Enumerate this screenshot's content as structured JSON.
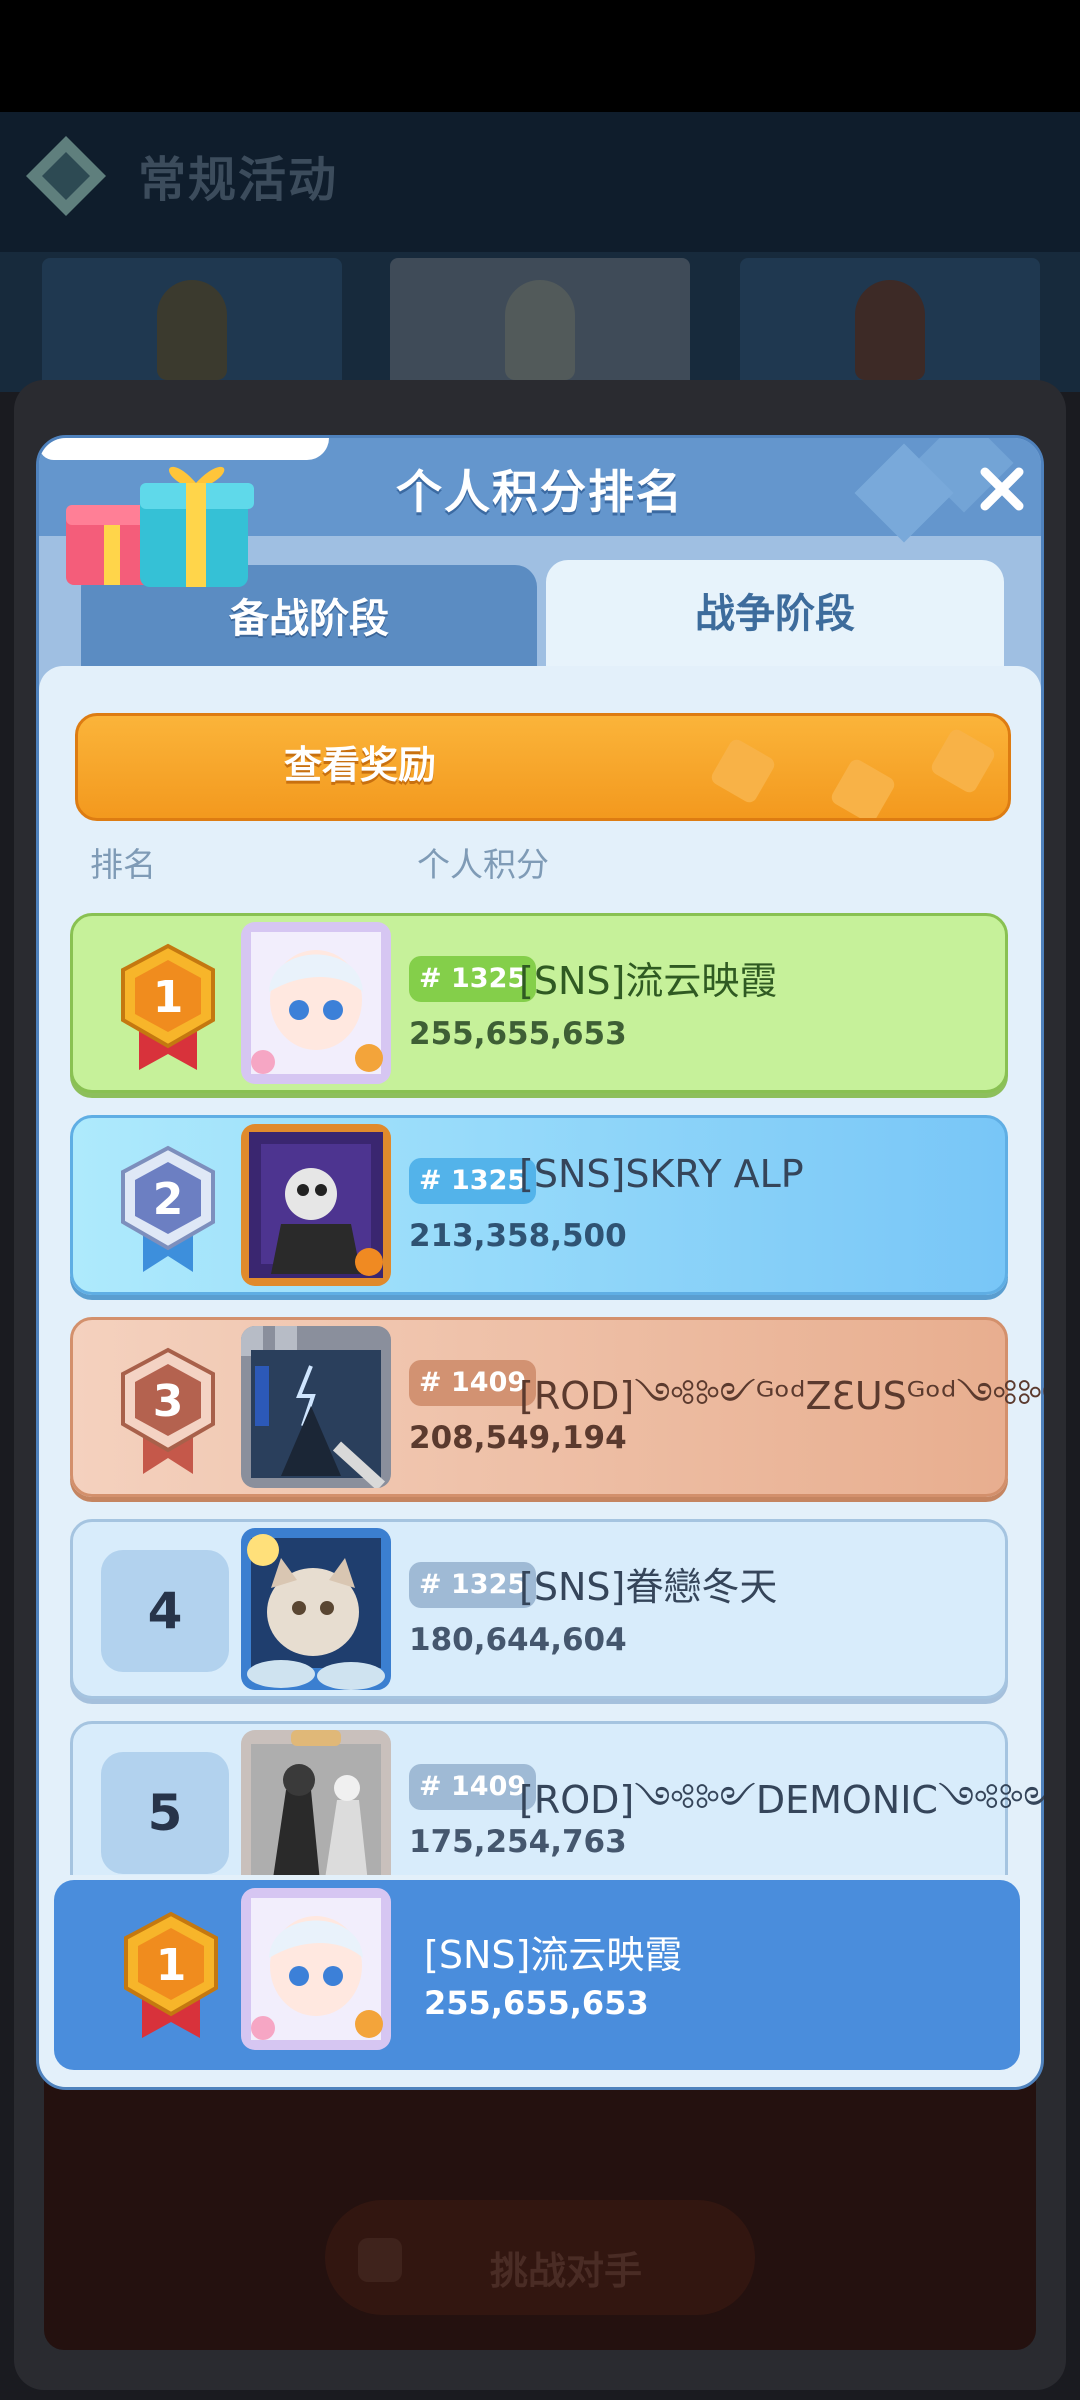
{
  "background": {
    "title": "常规活动",
    "button_label": "挑战对手"
  },
  "modal": {
    "title": "个人积分排名",
    "close_icon": "close-icon",
    "tabs": [
      {
        "label": "备战阶段",
        "active": false
      },
      {
        "label": "战争阶段",
        "active": true
      }
    ],
    "reward_button": "查看奖励",
    "columns": {
      "rank": "排名",
      "score": "个人积分"
    },
    "entries": [
      {
        "rank": "1",
        "medal": "gold-medal-icon",
        "server": "# 1325",
        "name": "[SNS]流云映霞",
        "score": "255,655,653",
        "color": "#c6f19a"
      },
      {
        "rank": "2",
        "medal": "silver-medal-icon",
        "server": "# 1325",
        "name": "[SNS]SKRY ALP",
        "score": "213,358,500",
        "color": "#78c6f7"
      },
      {
        "rank": "3",
        "medal": "bronze-medal-icon",
        "server": "# 1409",
        "name": "[ROD]༺༻ᴳᵒᵈZƐUSᴳᵒᵈ༺༻",
        "score": "208,549,194",
        "color": "#e8ae8f"
      },
      {
        "rank": "4",
        "server": "# 1325",
        "name": "[SNS]眷戀冬天",
        "score": "180,644,604",
        "color": "#d8ecfb"
      },
      {
        "rank": "5",
        "server": "# 1409",
        "name": "[ROD]༺༻DEMONIC༺༻",
        "score": "175,254,763",
        "color": "#d8ecfb"
      }
    ],
    "my_rank": {
      "rank": "1",
      "name": "[SNS]流云映霞",
      "score": "255,655,653"
    }
  }
}
